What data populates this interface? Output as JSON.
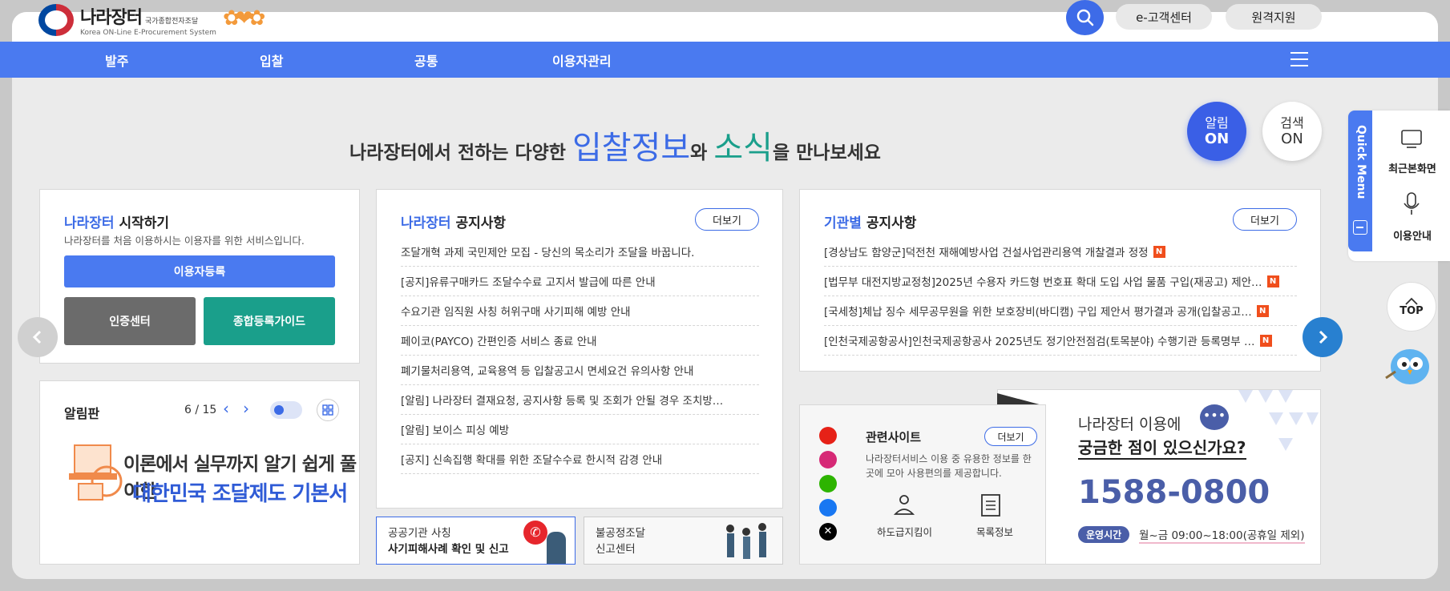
{
  "header": {
    "logo_main": "나라장터",
    "logo_kr": "국가종합전자조달",
    "logo_en": "Korea ON-Line E-Procurement System",
    "customer_center": "e-고객센터",
    "remote_support": "원격지원"
  },
  "nav": {
    "items": [
      "발주",
      "입찰",
      "공통",
      "이용자관리"
    ]
  },
  "headline": {
    "prefix": "나라장터에서 전하는 다양한",
    "bid_info": "입찰정보",
    "wa": "와",
    "news": "소식",
    "suffix": "을 만나보세요"
  },
  "toggles": {
    "alert_on_1": "알림",
    "alert_on_2": "ON",
    "search_on_1": "검색",
    "search_on_2": "ON"
  },
  "start": {
    "title_hl": "나라장터",
    "title": " 시작하기",
    "desc": "나라장터를 처음 이용하시는 이용자를 위한 서비스입니다.",
    "register": "이용자등록",
    "cert_center": "인증센터",
    "reg_guide": "종합등록가이드"
  },
  "board": {
    "title": "알림판",
    "page": "6 / 15",
    "banner_line1": "이론에서 실무까지 알기 쉽게 풀이한",
    "banner_line2": "대한민국 조달제도 기본서"
  },
  "notices": {
    "title_hl": "나라장터",
    "title": " 공지사항",
    "more": "더보기",
    "items": [
      "조달개혁 과제 국민제안 모집 - 당신의 목소리가 조달을 바꿉니다.",
      "[공지]유류구매카드 조달수수료 고지서 발급에 따른 안내",
      "수요기관 임직원 사칭 허위구매 사기피해 예방 안내",
      "페이코(PAYCO) 간편인증 서비스 종료 안내",
      "폐기물처리용역, 교육용역 등 입찰공고시 면세요건 유의사항 안내",
      "[알림] 나라장터 결재요청, 공지사항 등록 및 조회가 안될 경우 조치방…",
      "[알림] 보이스 피싱 예방",
      "[공지] 신속집행 확대를 위한 조달수수료 한시적 감경 안내"
    ]
  },
  "agency_notices": {
    "title_hl": "기관별",
    "title": " 공지사항",
    "more": "더보기",
    "new_badge": "N",
    "items": [
      "[경상남도 함양군]덕전천 재해예방사업 건설사업관리용역 개찰결과 정정",
      "[법무부 대전지방교정청]2025년 수용자 카드형 번호표 확대 도입 사업 물품 구입(재공고) 제안…",
      "[국세청]체납 징수 세무공무원을 위한 보호장비(바디캠) 구입 제안서 평가결과 공개(입찰공고…",
      "[인천국제공항공사]인천국제공항공사 2025년도 정기안전점검(토목분야) 수행기관 등록명부 …"
    ]
  },
  "promos": {
    "fraud_line1": "공공기관 사칭",
    "fraud_line2": "사기피해사례 확인 및 신고",
    "unfair_line1": "불공정조달",
    "unfair_line2": "신고센터"
  },
  "related": {
    "title": "관련사이트",
    "more": "더보기",
    "desc": "나라장터서비스 이용 중 유용한 정보를 한 곳에 모아 사용편의를 제공합니다.",
    "link1": "하도급지킴이",
    "link2": "목록정보"
  },
  "callcenter": {
    "line1": "나라장터 이용에",
    "line2": "궁금한 점이 있으신가요?",
    "phone": "1588-0800",
    "hours_label": "운영시간",
    "hours": "월~금 09:00~18:00(공휴일 제외)"
  },
  "quick_menu": {
    "tab": "Quick Menu",
    "recent": "최근본화면",
    "guide": "이용안내",
    "top": "TOP"
  },
  "colors": {
    "primary": "#4a7af0",
    "teal": "#1a9f8b",
    "gray_btn": "#6b6b6b",
    "badge": "#f04e1c",
    "phone": "#4a5ea8"
  }
}
